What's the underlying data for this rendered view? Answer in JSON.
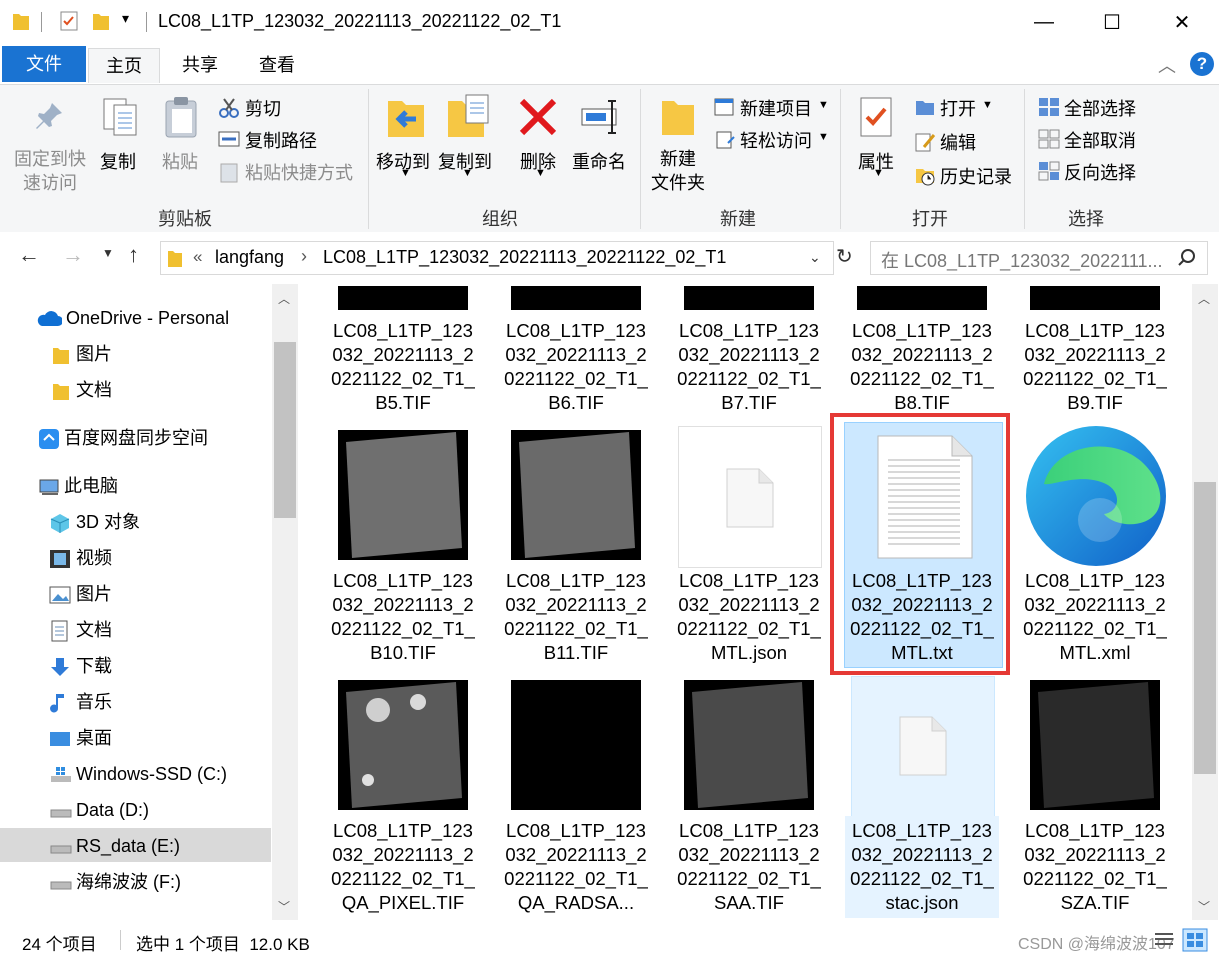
{
  "window": {
    "title": "LC08_L1TP_123032_20221113_20221122_02_T1",
    "minimize": "—",
    "maximize": "☐",
    "close": "✕"
  },
  "tabs": {
    "file": "文件",
    "home": "主页",
    "share": "共享",
    "view": "查看"
  },
  "ribbon": {
    "clipboard": {
      "pin": "固定到快速访问",
      "pin_l1": "固定到快",
      "pin_l2": "速访问",
      "copy": "复制",
      "paste": "粘贴",
      "cut": "剪切",
      "copy_path": "复制路径",
      "paste_shortcut": "粘贴快捷方式",
      "group": "剪贴板"
    },
    "organize": {
      "move_to": "移动到",
      "copy_to": "复制到",
      "delete": "删除",
      "rename": "重命名",
      "group": "组织"
    },
    "new": {
      "new_folder_l1": "新建",
      "new_folder_l2": "文件夹",
      "new_item": "新建项目",
      "easy_access": "轻松访问",
      "group": "新建"
    },
    "open": {
      "properties": "属性",
      "open": "打开",
      "edit": "编辑",
      "history": "历史记录",
      "group": "打开"
    },
    "select": {
      "select_all": "全部选择",
      "select_none": "全部取消",
      "invert": "反向选择",
      "group": "选择"
    }
  },
  "address": {
    "overflow": "«",
    "crumb1": "langfang",
    "crumb2": "LC08_L1TP_123032_20221113_20221122_02_T1",
    "search_placeholder": "在 LC08_L1TP_123032_2022111..."
  },
  "nav": [
    {
      "label": "OneDrive - Personal"
    },
    {
      "label": "图片"
    },
    {
      "label": "文档"
    },
    {
      "label": "百度网盘同步空间"
    },
    {
      "label": "此电脑"
    },
    {
      "label": "3D 对象"
    },
    {
      "label": "视频"
    },
    {
      "label": "图片"
    },
    {
      "label": "文档"
    },
    {
      "label": "下载"
    },
    {
      "label": "音乐"
    },
    {
      "label": "桌面"
    },
    {
      "label": "Windows-SSD (C:)"
    },
    {
      "label": "Data (D:)"
    },
    {
      "label": "RS_data (E:)"
    },
    {
      "label": "海绵波波 (F:)"
    }
  ],
  "files": [
    {
      "name": "LC08_L1TP_123032_20221113_20221122_02_T1_B5.TIF"
    },
    {
      "name": "LC08_L1TP_123032_20221113_20221122_02_T1_B6.TIF"
    },
    {
      "name": "LC08_L1TP_123032_20221113_20221122_02_T1_B7.TIF"
    },
    {
      "name": "LC08_L1TP_123032_20221113_20221122_02_T1_B8.TIF"
    },
    {
      "name": "LC08_L1TP_123032_20221113_20221122_02_T1_B9.TIF"
    },
    {
      "name": "LC08_L1TP_123032_20221113_20221122_02_T1_B10.TIF"
    },
    {
      "name": "LC08_L1TP_123032_20221113_20221122_02_T1_B11.TIF"
    },
    {
      "name": "LC08_L1TP_123032_20221113_20221122_02_T1_MTL.json"
    },
    {
      "name": "LC08_L1TP_123032_20221113_20221122_02_T1_MTL.txt"
    },
    {
      "name": "LC08_L1TP_123032_20221113_20221122_02_T1_MTL.xml"
    },
    {
      "name": "LC08_L1TP_123032_20221113_20221122_02_T1_QA_PIXEL.TIF"
    },
    {
      "name": "LC08_L1TP_123032_20221113_20221122_02_T1_QA_RADSA..."
    },
    {
      "name": "LC08_L1TP_123032_20221113_20221122_02_T1_SAA.TIF"
    },
    {
      "name": "LC08_L1TP_123032_20221113_20221122_02_T1_stac.json"
    },
    {
      "name": "LC08_L1TP_123032_20221113_20221122_02_T1_SZA.TIF"
    }
  ],
  "status": {
    "count": "24 个项目",
    "selected": "选中 1 个项目  12.0 KB",
    "watermark": "CSDN @海绵波波107"
  },
  "colors": {
    "accent": "#1a73d2",
    "selection": "#cce8ff",
    "highlight_box": "#e53935"
  }
}
